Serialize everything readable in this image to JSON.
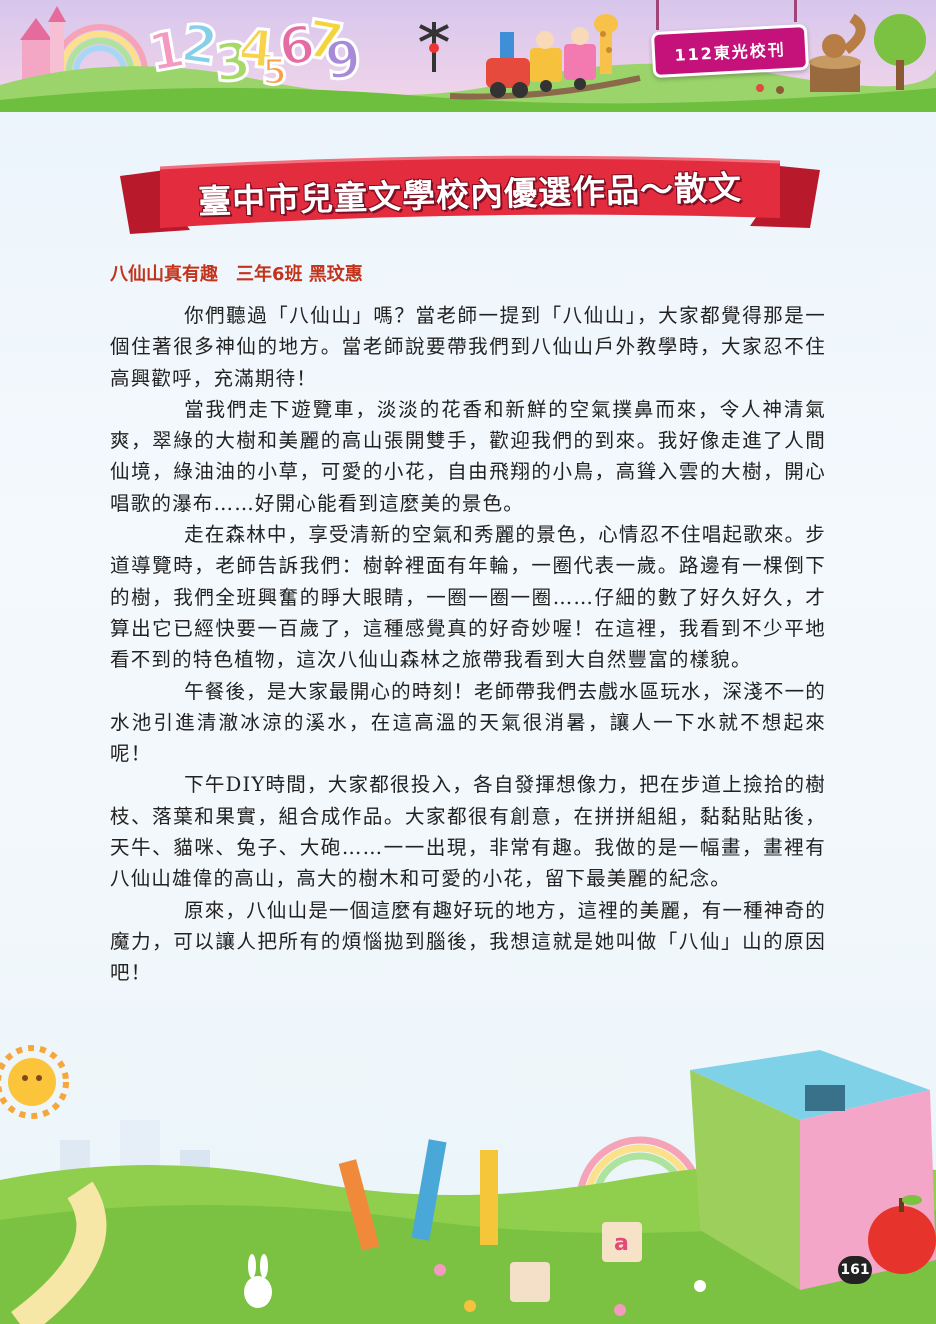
{
  "header": {
    "school_tag": "112東光校刊",
    "numbers_art": "12345679",
    "icons": [
      "rainbow-icon",
      "train-icon",
      "giraffe-icon",
      "squirrel-icon",
      "castle-icon"
    ]
  },
  "banner": {
    "title": "臺中市兒童文學校內優選作品～散文",
    "color": "#e32d3f"
  },
  "article": {
    "heading": "八仙山真有趣　三年6班 黑玟惠",
    "paragraphs": [
      "你們聽過「八仙山」嗎？當老師一提到「八仙山」，大家都覺得那是一個住著很多神仙的地方。當老師說要帶我們到八仙山戶外教學時，大家忍不住高興歡呼，充滿期待！",
      "當我們走下遊覽車，淡淡的花香和新鮮的空氣撲鼻而來，令人神清氣爽，翠綠的大樹和美麗的高山張開雙手，歡迎我們的到來。我好像走進了人間仙境，綠油油的小草，可愛的小花，自由飛翔的小鳥，高聳入雲的大樹，開心唱歌的瀑布……好開心能看到這麼美的景色。",
      "走在森林中，享受清新的空氣和秀麗的景色，心情忍不住唱起歌來。步道導覽時，老師告訴我們：樹幹裡面有年輪，一圈代表一歲。路邊有一棵倒下的樹，我們全班興奮的睜大眼睛，一圈一圈一圈……仔細的數了好久好久，才算出它已經快要一百歲了，這種感覺真的好奇妙喔！在這裡，我看到不少平地看不到的特色植物，這次八仙山森林之旅帶我看到大自然豐富的樣貌。",
      "午餐後，是大家最開心的時刻！老師帶我們去戲水區玩水，深淺不一的水池引進清澈冰涼的溪水，在這高溫的天氣很消暑，讓人一下水就不想起來呢！",
      "下午DIY時間，大家都很投入，各自發揮想像力，把在步道上撿拾的樹枝、落葉和果實，組合成作品。大家都很有創意，在拼拼組組，黏黏貼貼後，天牛、貓咪、兔子、大砲……一一出現，非常有趣。我做的是一幅畫，畫裡有八仙山雄偉的高山，高大的樹木和可愛的小花，留下最美麗的紀念。",
      "原來，八仙山是一個這麼有趣好玩的地方，這裡的美麗，有一種神奇的魔力，可以讓人把所有的煩惱拋到腦後，我想這就是她叫做「八仙」山的原因吧！"
    ]
  },
  "footer": {
    "page_number": "161",
    "icons": [
      "rubiks-cube-icon",
      "apple-icon",
      "sun-icon",
      "pencil-icon",
      "rabbit-icon",
      "rainbow-icon",
      "letter-block-icon"
    ]
  },
  "colors": {
    "heading": "#c2341c",
    "tag": "#c4127a",
    "grass": "#7cc242",
    "background": "#eaf3fb"
  }
}
